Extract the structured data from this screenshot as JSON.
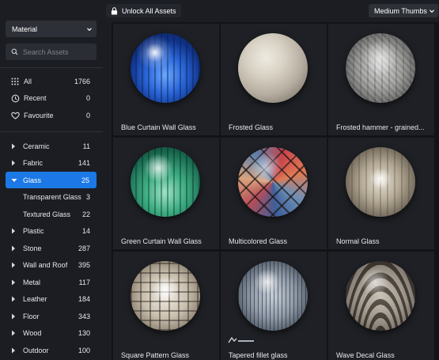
{
  "topbar": {
    "unlock_label": "Unlock All Assets",
    "thumbs_label": "Medium Thumbs"
  },
  "sidebar": {
    "material_select": "Material",
    "search_placeholder": "Search Assets",
    "quick": [
      {
        "label": "All",
        "count": "1766",
        "icon": "grid-icon"
      },
      {
        "label": "Recent",
        "count": "0",
        "icon": "clock-icon"
      },
      {
        "label": "Favourite",
        "count": "0",
        "icon": "heart-icon"
      }
    ],
    "categories": [
      {
        "label": "Ceramic",
        "count": "11"
      },
      {
        "label": "Fabric",
        "count": "141"
      },
      {
        "label": "Glass",
        "count": "25",
        "active": true
      },
      {
        "label": "Transparent Glass",
        "count": "3",
        "sub": true
      },
      {
        "label": "Textured Glass",
        "count": "22",
        "sub": true
      },
      {
        "label": "Plastic",
        "count": "14"
      },
      {
        "label": "Stone",
        "count": "287"
      },
      {
        "label": "Wall and Roof",
        "count": "395"
      },
      {
        "label": "Metal",
        "count": "117"
      },
      {
        "label": "Leather",
        "count": "184"
      },
      {
        "label": "Floor",
        "count": "343"
      },
      {
        "label": "Wood",
        "count": "130"
      },
      {
        "label": "Outdoor",
        "count": "100"
      }
    ]
  },
  "assets": [
    {
      "name": "Blue Curtain Wall Glass",
      "style": "s-blue"
    },
    {
      "name": "Frosted Glass",
      "style": "s-frosted"
    },
    {
      "name": "Frosted hammer - grained...",
      "style": "s-hammer"
    },
    {
      "name": "Green Curtain Wall Glass",
      "style": "s-green"
    },
    {
      "name": "Multicolored Glass",
      "style": "s-multi"
    },
    {
      "name": "Normal Glass",
      "style": "s-normal"
    },
    {
      "name": "Square Pattern Glass",
      "style": "s-square"
    },
    {
      "name": "Tapered fillet glass",
      "style": "s-tapered"
    },
    {
      "name": "Wave Decal Glass",
      "style": "s-wave"
    }
  ],
  "colors": {
    "accent": "#1b78e6",
    "panel": "#1b1d22",
    "grid_bg": "#111316",
    "card_bg": "#1e2025"
  }
}
